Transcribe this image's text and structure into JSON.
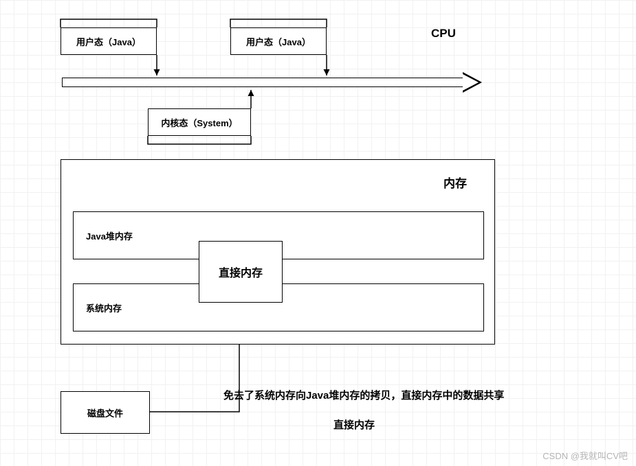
{
  "cpu_label": "CPU",
  "user_mode_1": "用户态（Java）",
  "user_mode_2": "用户态（Java）",
  "kernel_mode": "内核态（System）",
  "memory_title": "内存",
  "java_heap": "Java堆内存",
  "system_memory": "系统内存",
  "direct_memory": "直接内存",
  "disk_file": "磁盘文件",
  "caption_line1": "免去了系统内存向Java堆内存的拷贝，直接内存中的数据共享",
  "caption_line2": "直接内存",
  "watermark": "CSDN @我就叫CV吧"
}
